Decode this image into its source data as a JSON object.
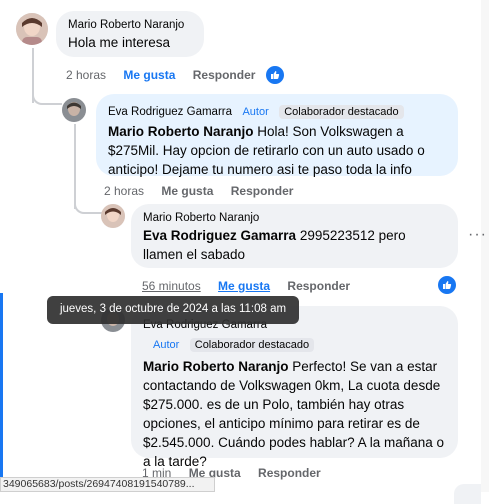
{
  "comments": [
    {
      "author": "Mario Roberto Naranjo",
      "text": "Hola me interesa",
      "time": "2 horas",
      "like": "Me gusta",
      "reply": "Responder"
    },
    {
      "author": "Eva Rodriguez Gamarra",
      "role": "Autor",
      "badge": "Colaborador destacado",
      "mention": "Mario Roberto Naranjo",
      "text": " Hola! Son Volkswagen a $275Mil. Hay opcion de retirarlo con un auto usado o anticipo! Dejame tu numero asi te paso toda la info",
      "time": "2 horas",
      "like": "Me gusta",
      "reply": "Responder"
    },
    {
      "author": "Mario Roberto Naranjo",
      "mention": "Eva Rodriguez Gamarra",
      "text": " 2995223512 pero llamen el sabado",
      "time": "56 minutos",
      "like": "Me gusta",
      "reply": "Responder",
      "more": "···"
    },
    {
      "author": "Eva Rodriguez Gamarra",
      "role": "Autor",
      "badge": "Colaborador destacado",
      "mention": "Mario Roberto Naranjo",
      "text": " Perfecto! Se van a estar contactando de Volkswagen 0km, La cuota desde $275.000. es de un Polo, también hay otras opciones, el anticipo mínimo para retirar es de $2.545.000. Cuándo podes hablar? A la mañana o a la tarde?",
      "time": "1 min",
      "like": "Me gusta",
      "reply": "Responder"
    }
  ],
  "tooltip": "jueves, 3 de octubre de 2024 a las 11:08 am",
  "status_url": "349065683/posts/26947408191540789...",
  "colors": {
    "accent": "#1877f2",
    "bubble": "#f0f2f5",
    "bubble_author": "#e7f3ff",
    "secondary": "#65676b"
  }
}
